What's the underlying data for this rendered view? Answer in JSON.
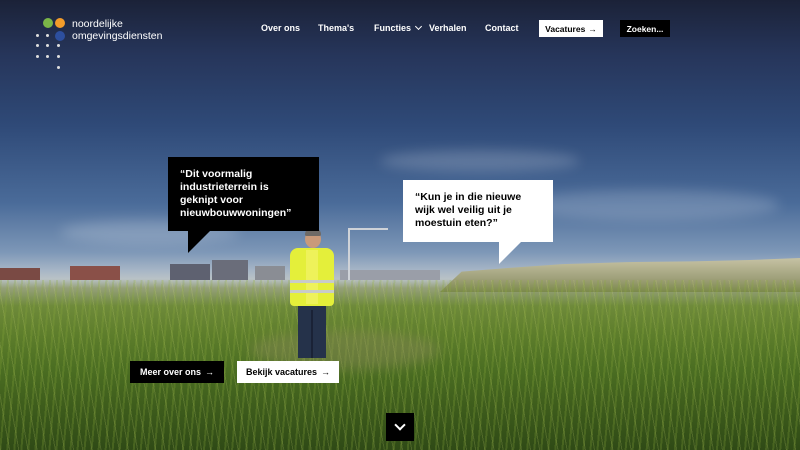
{
  "brand": {
    "line1": "noordelijke",
    "line2": "omgevingsdiensten",
    "colors": {
      "green": "#7ab648",
      "orange": "#f39c2a",
      "blue": "#2d4f9e",
      "grey": "#d9d9d9"
    }
  },
  "nav": {
    "items": [
      {
        "label": "Over ons"
      },
      {
        "label": "Thema's"
      },
      {
        "label": "Functies"
      },
      {
        "label": "Verhalen"
      },
      {
        "label": "Contact"
      }
    ],
    "vacatures_label": "Vacatures",
    "vacatures_icon": "arrow-right-icon",
    "search_label": "Zoeken..."
  },
  "hero": {
    "quote_left": "“Dit voormalig industrieterrein is geknipt voor nieuwbouwwoningen”",
    "quote_right": "“Kun je in die nieuwe wijk wel veilig uit je moestuin eten?”",
    "cta_primary": "Meer over ons",
    "cta_secondary": "Bekijk vacatures",
    "arrow_glyph": "→",
    "scroll_icon": "chevron-down-icon"
  }
}
